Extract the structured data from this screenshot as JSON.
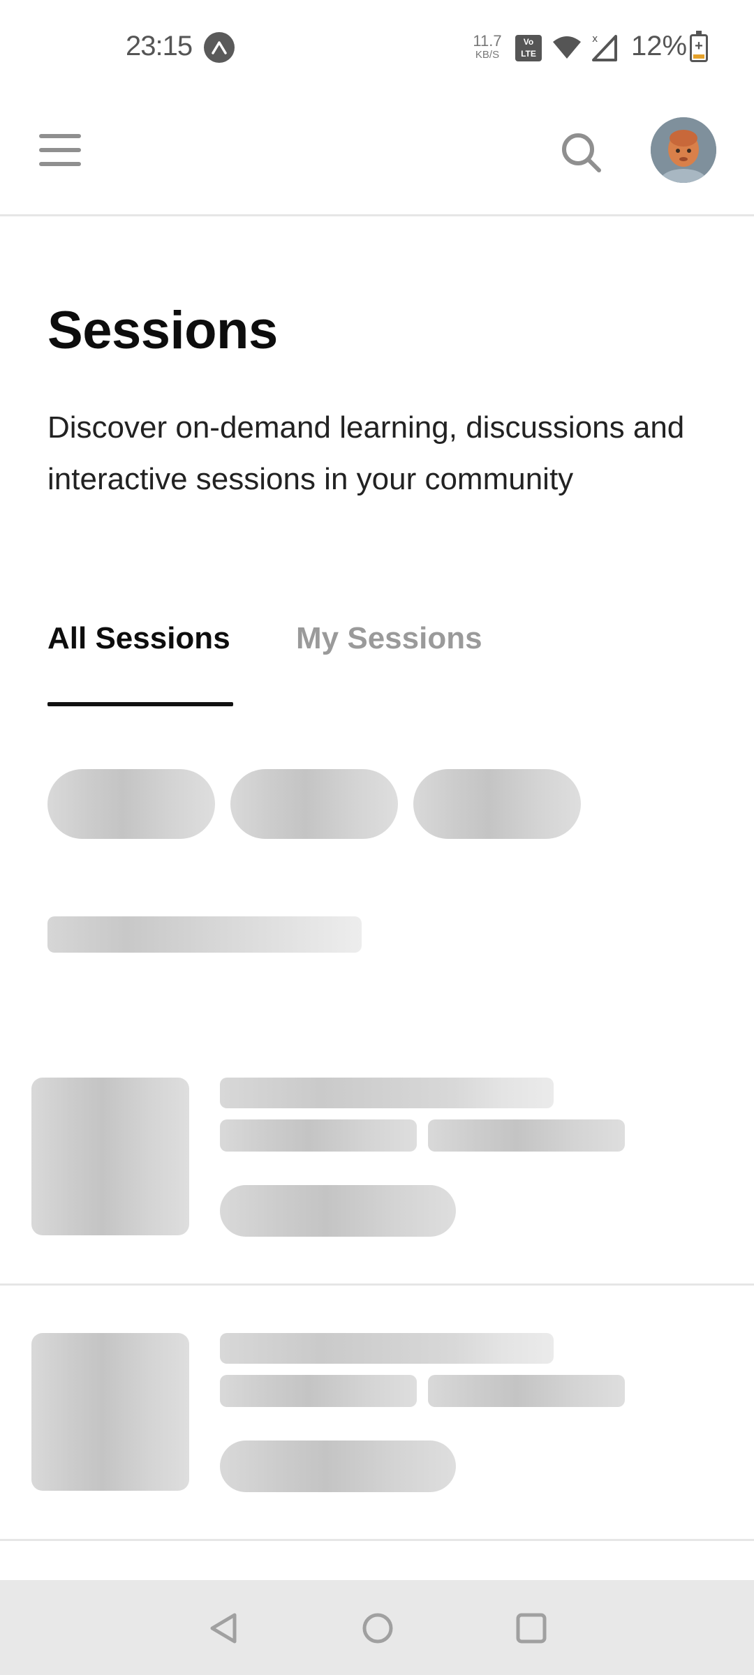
{
  "status_bar": {
    "time": "23:15",
    "app_icon": "nova-launcher-icon",
    "net_speed_value": "11.7",
    "net_speed_unit": "KB/S",
    "volte_label": "Vo LTE",
    "battery_text": "12%"
  },
  "header": {
    "menu_icon": "hamburger-menu-icon",
    "search_icon": "search-icon",
    "avatar": "user-avatar"
  },
  "page": {
    "title": "Sessions",
    "description": "Discover on-demand learning, discussions and interactive sessions in your community"
  },
  "tabs": [
    {
      "label": "All Sessions",
      "active": true
    },
    {
      "label": "My Sessions",
      "active": false
    }
  ],
  "loading": {
    "skeleton_chip_count": 3,
    "skeleton_card_count": 2
  },
  "nav": {
    "back_icon": "nav-back-icon",
    "home_icon": "nav-home-icon",
    "recents_icon": "nav-recents-icon"
  },
  "colors": {
    "accent": "#111111",
    "inactive_tab": "#9a9a9a",
    "skeleton": "#cccccc",
    "nav_bar_bg": "#e8e8e8"
  }
}
